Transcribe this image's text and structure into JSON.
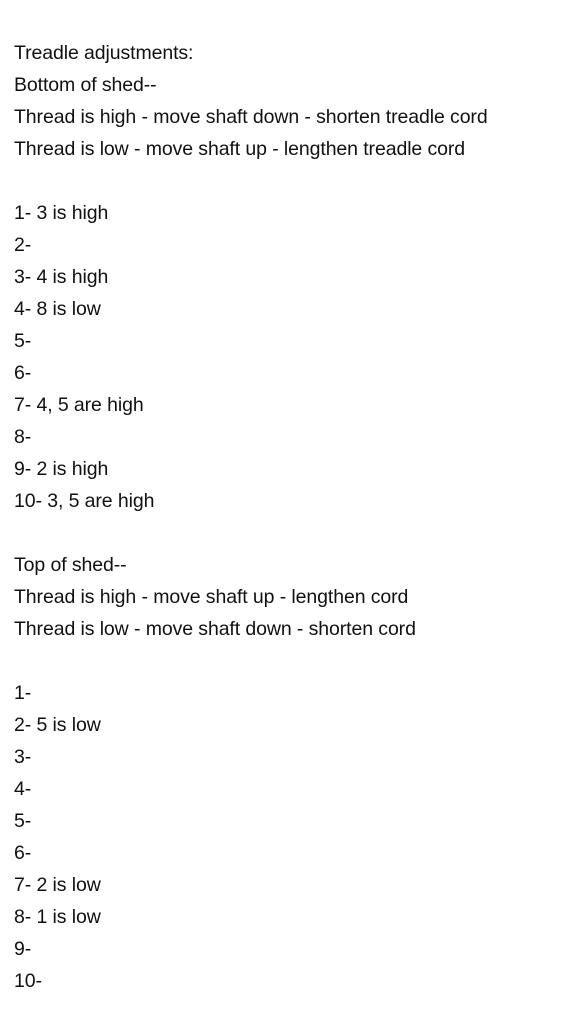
{
  "note": {
    "title": "Treadle adjustments:",
    "bottom": {
      "heading": "Bottom of shed--",
      "rules": [
        "Thread is high - move shaft down - shorten treadle cord",
        "Thread is low - move shaft up - lengthen treadle cord"
      ],
      "items": [
        "1- 3 is high",
        "2-",
        "3- 4 is high",
        "4- 8 is low",
        "5-",
        "6-",
        "7- 4, 5 are high",
        "8-",
        "9- 2 is high",
        "10- 3, 5 are high"
      ]
    },
    "top": {
      "heading": "Top of shed--",
      "rules": [
        "Thread is high - move shaft up - lengthen cord",
        "Thread is low - move shaft down - shorten cord"
      ],
      "items": [
        "1-",
        "2- 5 is low",
        "3-",
        "4-",
        "5-",
        "6-",
        "7- 2 is low",
        "8- 1 is low",
        "9-",
        "10-"
      ]
    }
  }
}
